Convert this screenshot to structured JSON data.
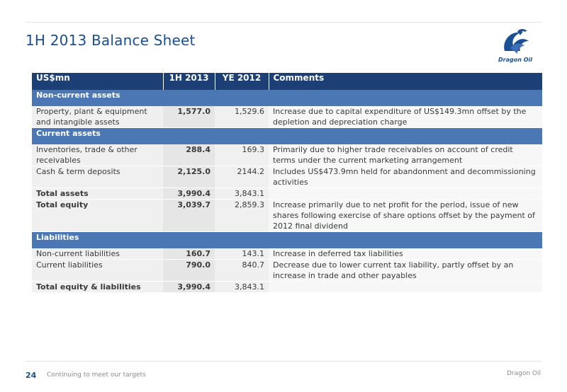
{
  "title": "1H 2013 Balance Sheet",
  "logo": {
    "text": "Dragon Oil",
    "icon": "dragon-icon",
    "color": "#1a4f94"
  },
  "table": {
    "headers": [
      "US$mn",
      "1H 2013",
      "YE 2012",
      "Comments"
    ],
    "rows": [
      {
        "type": "section",
        "label": "Non-current assets"
      },
      {
        "type": "data",
        "label": "Property, plant & equipment and intangible assets",
        "h1_2013": "1,577.0",
        "ye_2012": "1,529.6",
        "comment": "Increase due to capital expenditure of US$149.3mn offset by the depletion and depreciation charge"
      },
      {
        "type": "section",
        "label": "Current assets"
      },
      {
        "type": "data",
        "label": "Inventories, trade & other receivables",
        "h1_2013": "288.4",
        "ye_2012": "169.3",
        "comment": "Primarily due to higher trade receivables on account of credit terms under the current marketing arrangement"
      },
      {
        "type": "data",
        "label": "Cash & term deposits",
        "h1_2013": "2,125.0",
        "ye_2012": "2144.2",
        "comment": "Includes US$473.9mn held for abandonment and decommissioning activities"
      },
      {
        "type": "total",
        "label": "Total assets",
        "h1_2013": "3,990.4",
        "ye_2012": "3,843.1",
        "comment": ""
      },
      {
        "type": "total",
        "label": "Total equity",
        "h1_2013": "3,039.7",
        "ye_2012": "2,859.3",
        "comment": "Increase primarily due to net profit for the period, issue of new shares following exercise of share options offset by the payment of 2012 final dividend"
      },
      {
        "type": "section",
        "label": "Liabilities"
      },
      {
        "type": "data",
        "label": "Non-current liabilities",
        "h1_2013": "160.7",
        "ye_2012": "143.1",
        "comment": "Increase in deferred tax liabilities"
      },
      {
        "type": "data",
        "label": "Current liabilities",
        "h1_2013": "790.0",
        "ye_2012": "840.7",
        "comment": "Decrease due to lower current tax liability, partly offset by an increase in trade and other payables"
      },
      {
        "type": "total",
        "label": "Total equity & liabilities",
        "h1_2013": "3,990.4",
        "ye_2012": "3,843.1",
        "comment": ""
      }
    ]
  },
  "footer": {
    "page_number": "24",
    "text": "Continuing to meet our targets",
    "brand": "Dragon Oil"
  },
  "colors": {
    "title": "#1a4f94",
    "header_bg": "#1c3f76",
    "section_bg": "#4b77b4"
  }
}
